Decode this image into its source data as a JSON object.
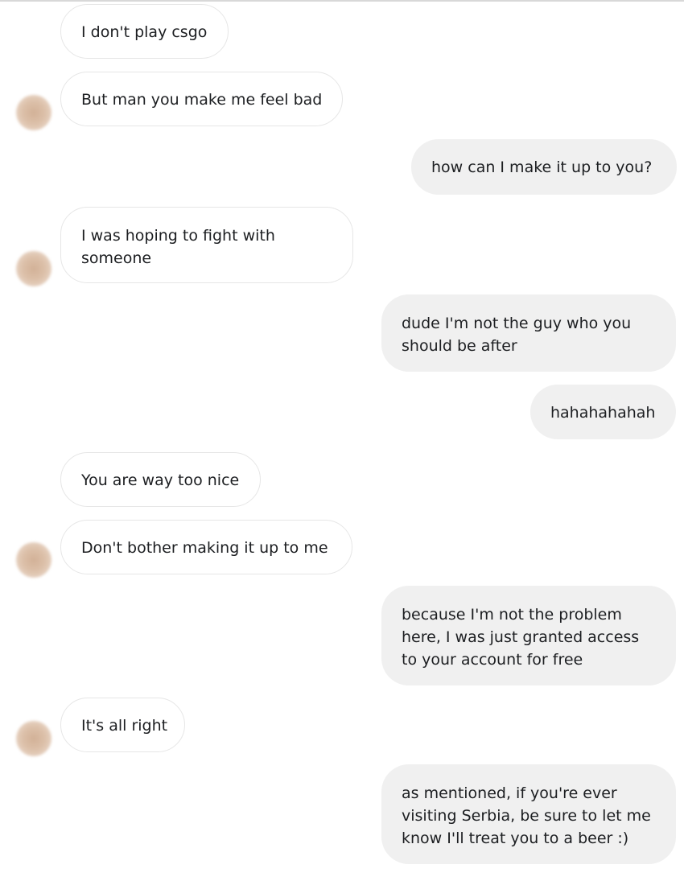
{
  "conversation": {
    "messages": [
      {
        "sender": "them",
        "lines": [
          "I don't play csgo"
        ]
      },
      {
        "sender": "them",
        "lines": [
          "But man you make me feel bad"
        ]
      },
      {
        "sender": "me",
        "lines": [
          "how can I make it up to you?"
        ]
      },
      {
        "sender": "them",
        "lines": [
          "I was hoping to fight with",
          "someone"
        ]
      },
      {
        "sender": "me",
        "lines": [
          "dude I'm not the guy who you",
          "should be after"
        ]
      },
      {
        "sender": "me",
        "lines": [
          "hahahahahah"
        ]
      },
      {
        "sender": "them",
        "lines": [
          "You are way too nice"
        ]
      },
      {
        "sender": "them",
        "lines": [
          "Don't bother making it up to me"
        ]
      },
      {
        "sender": "me",
        "lines": [
          "because I'm not the problem",
          "here, I was just granted access",
          "to your account for free"
        ]
      },
      {
        "sender": "them",
        "lines": [
          "It's all right"
        ]
      },
      {
        "sender": "me",
        "lines": [
          "as mentioned, if you're ever",
          "visiting Serbia, be sure to let me",
          "know I'll treat you to a beer :)"
        ]
      }
    ]
  },
  "colors": {
    "outgoing_bubble": "#f0f0f0",
    "incoming_bubble": "#ffffff",
    "incoming_border": "#e6e6e6",
    "text": "#1c1e21",
    "avatar": "#d2b197"
  },
  "icons": {
    "avatar": "blurred-avatar-icon"
  }
}
